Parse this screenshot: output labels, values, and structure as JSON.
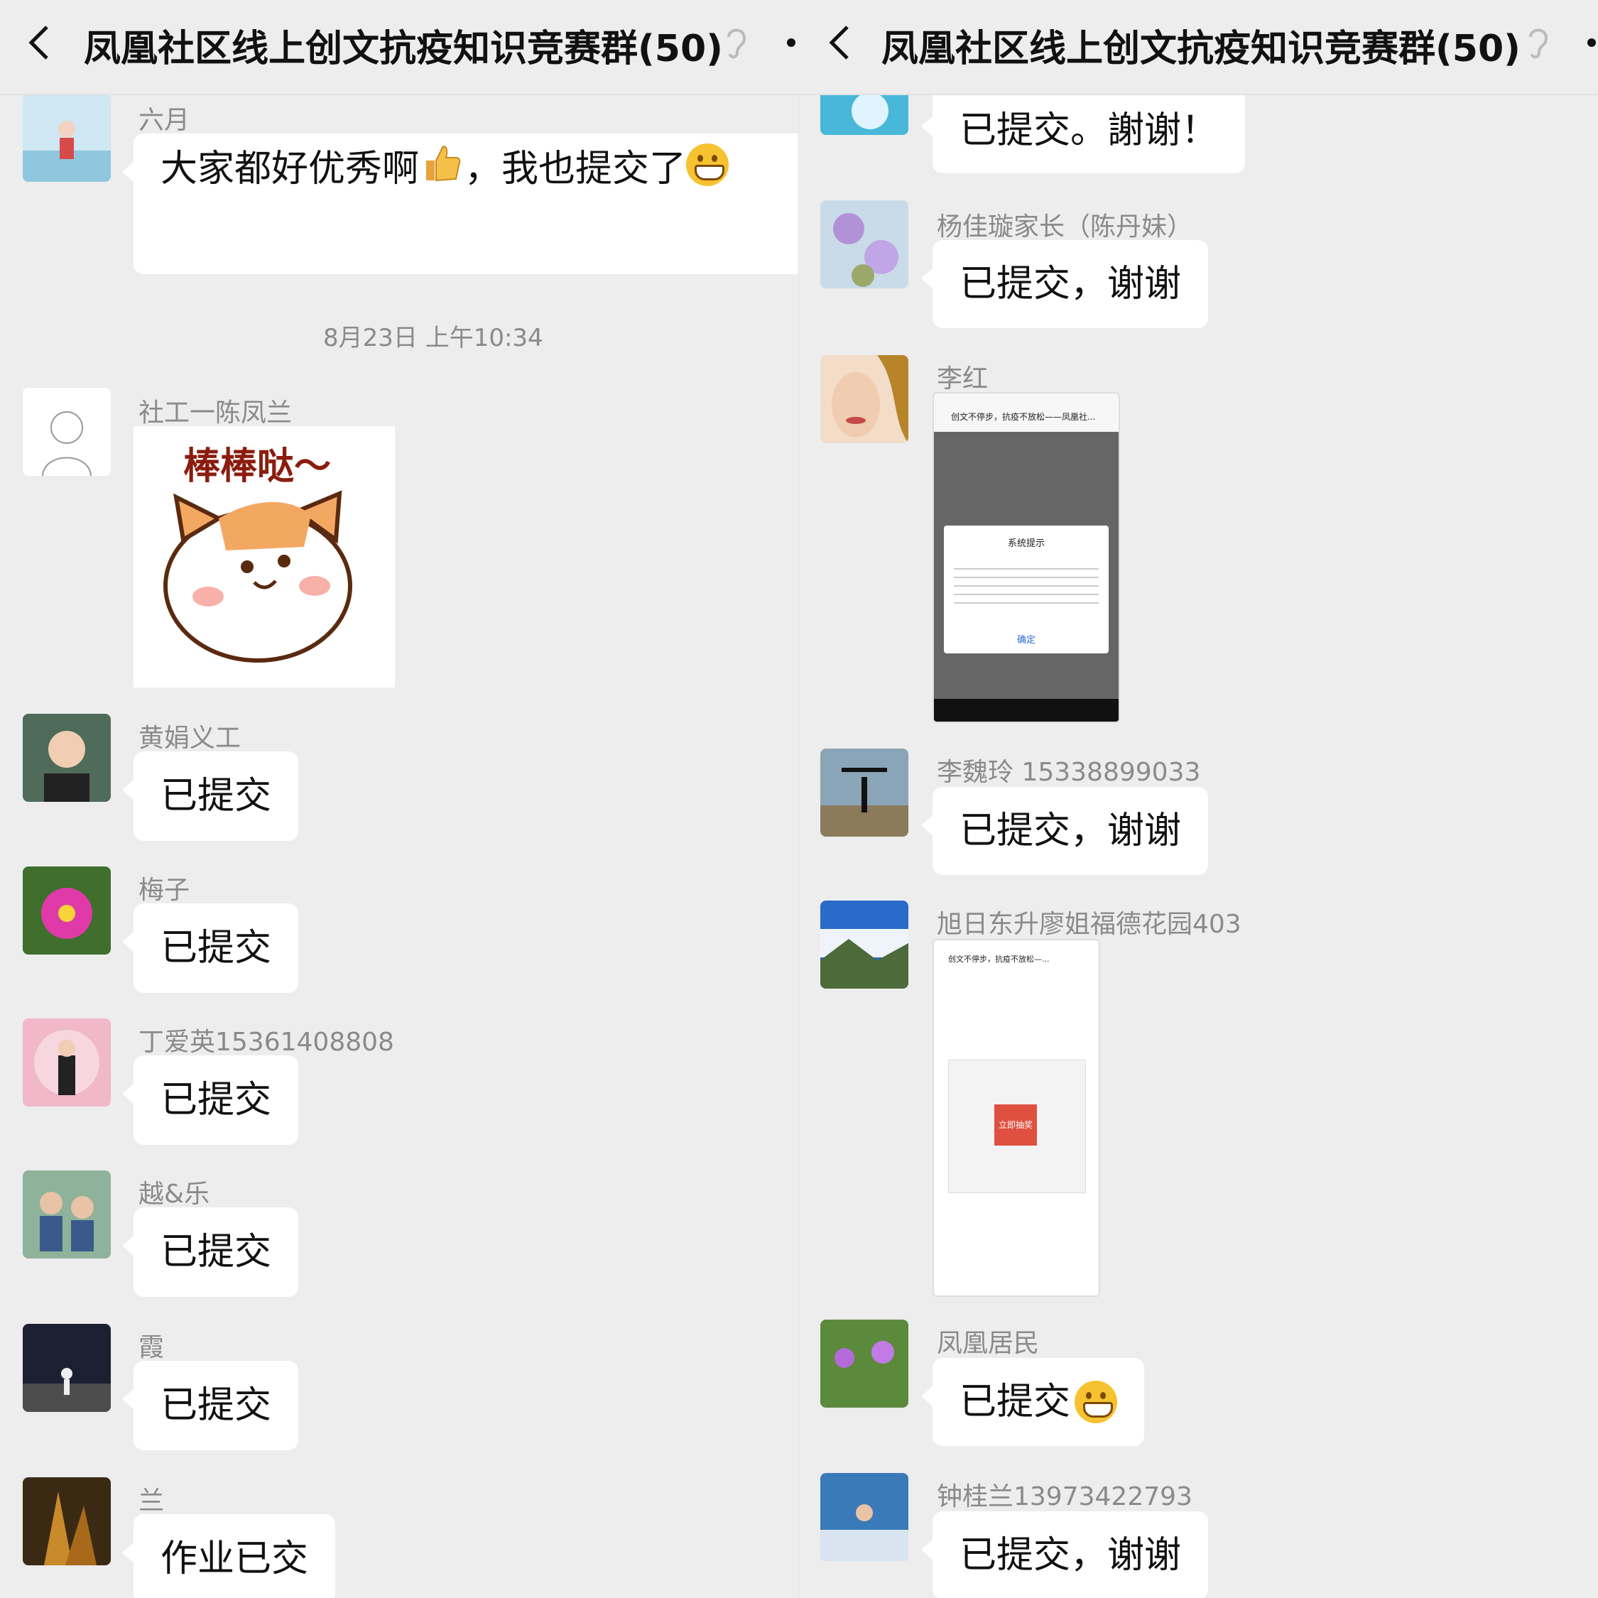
{
  "header": {
    "title": "凤凰社区线上创文抗疫知识竞赛群(50)"
  },
  "left": {
    "messages": [
      {
        "name": "六月",
        "text": "大家都好优秀啊",
        "text2": "，我也提交了"
      },
      {
        "time": "8月23日 上午10:34"
      },
      {
        "name": "社工一陈凤兰",
        "sticker_text": "棒棒哒～"
      },
      {
        "name": "黄娟义工",
        "text": "已提交"
      },
      {
        "name": "梅子",
        "text": "已提交"
      },
      {
        "name": "丁爱英15361408808",
        "text": "已提交"
      },
      {
        "name": "越&乐",
        "text": "已提交"
      },
      {
        "name": "霞",
        "text": "已提交"
      },
      {
        "name": "兰",
        "text": "作业已交"
      }
    ]
  },
  "right": {
    "messages": [
      {
        "text": "已提交。謝谢！"
      },
      {
        "name": "杨佳璇家长（陈丹妹）",
        "text": "已提交，谢谢"
      },
      {
        "name": "李红",
        "screenshot": {
          "title": "创文不停步，抗疫不放松——凤凰社...",
          "dialog_title": "系统提示",
          "dialog_button": "确定"
        }
      },
      {
        "name": "李魏玲 15338899033",
        "text": "已提交，谢谢"
      },
      {
        "name": "旭日东升廖姐福德花园403",
        "screenshot": {
          "title": "创文不停步，抗疫不放松—...",
          "center_button": "立即抽奖"
        }
      },
      {
        "name": "凤凰居民",
        "text": "已提交"
      },
      {
        "name": "钟桂兰13973422793",
        "text": "已提交，谢谢"
      }
    ]
  }
}
